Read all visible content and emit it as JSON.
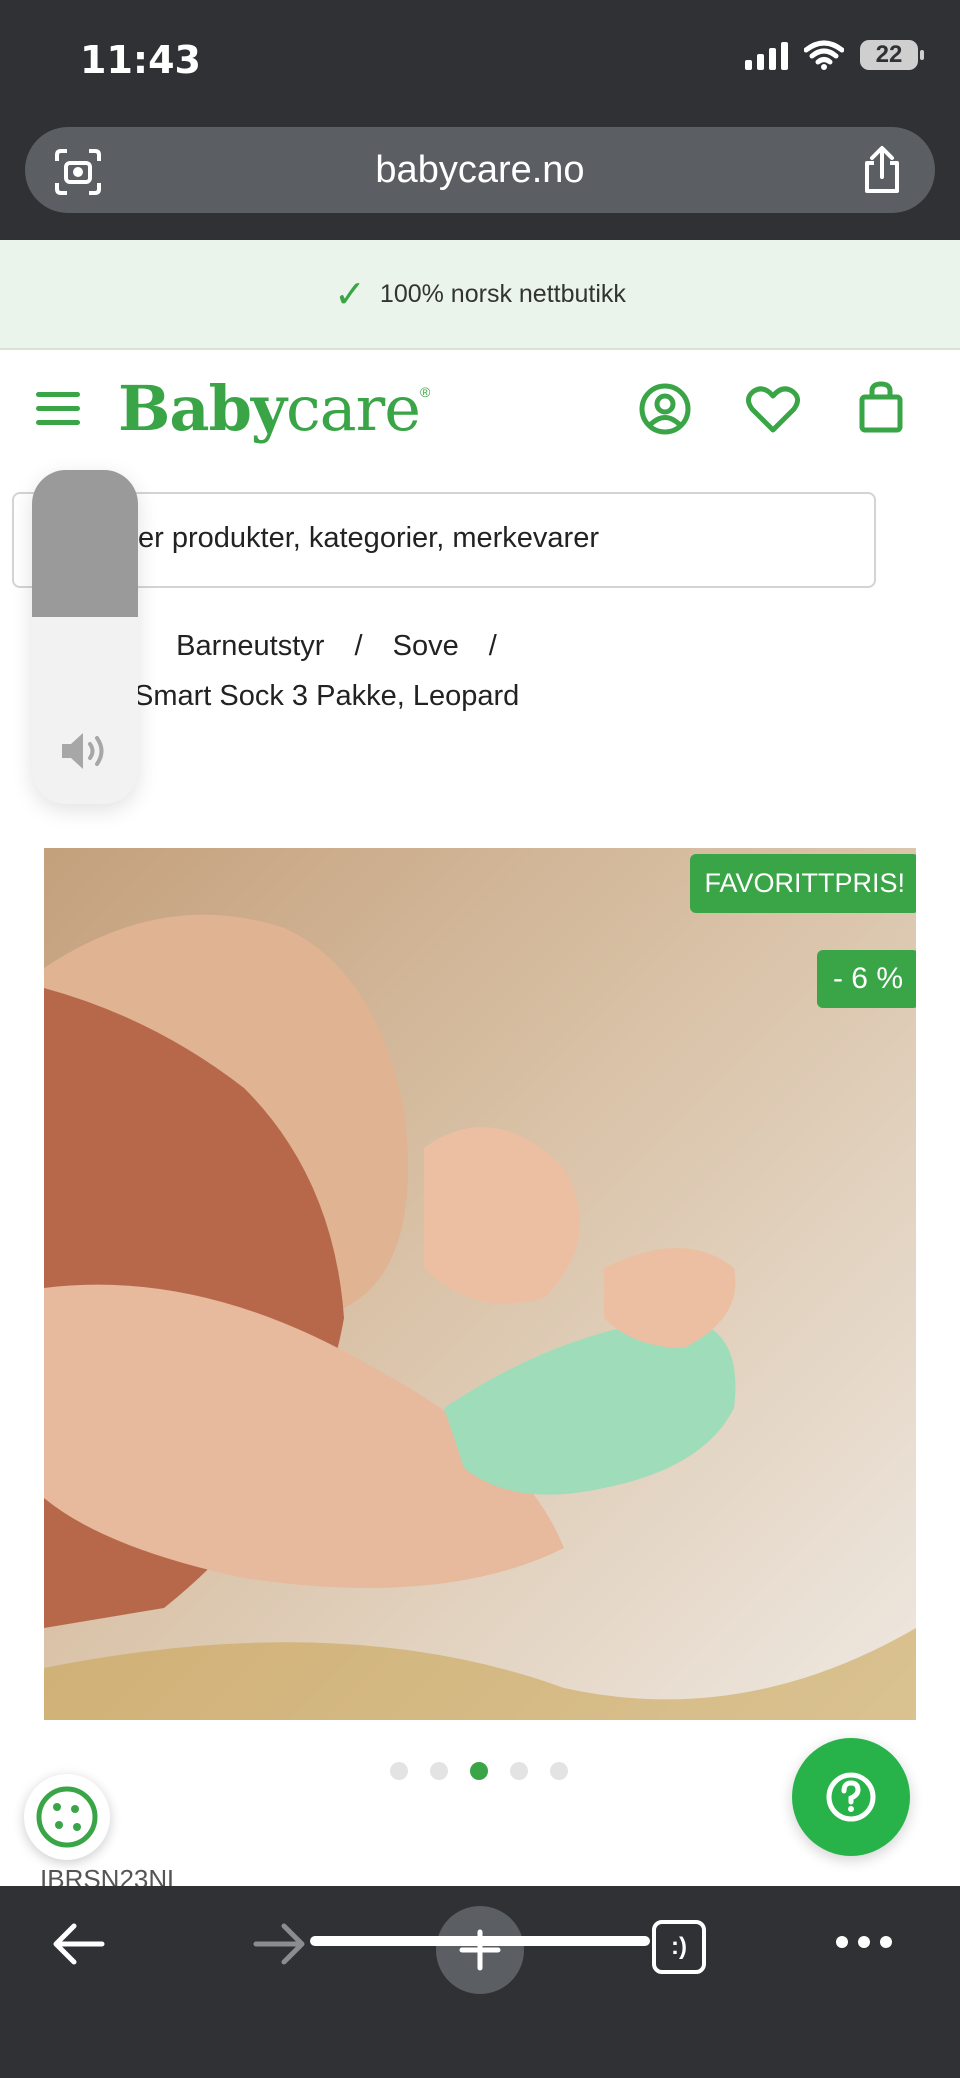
{
  "status_bar": {
    "time": "11:43",
    "battery": "22"
  },
  "browser": {
    "url": "babycare.no"
  },
  "promo": {
    "text": "100% norsk nettbutikk"
  },
  "header": {
    "logo_bold": "Baby",
    "logo_light": "care",
    "logo_mark": "®"
  },
  "search": {
    "text": "er produkter, kategorier, merkevarer"
  },
  "breadcrumb": {
    "sep1": "/",
    "item1": "Barneutstyr",
    "sep2": "/",
    "item2": "Sove",
    "sep3": "/",
    "current": "Smart Sock 3 Pakke, Leopard"
  },
  "product": {
    "badge_favorite": "FAVORITTPRIS!",
    "badge_discount": "- 6 %",
    "image_dots": 5,
    "active_dot": 3,
    "sku_partial": "IBRSN23NL"
  },
  "volume": {
    "level": 0.56
  },
  "colors": {
    "brand_green": "#3aa547",
    "help_green": "#28b34a",
    "chrome": "#2f3134"
  }
}
